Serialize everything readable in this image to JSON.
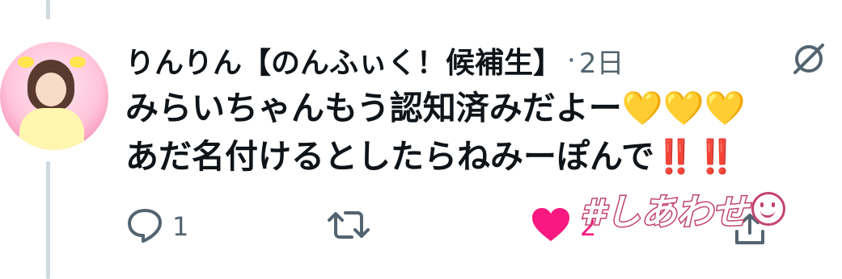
{
  "tweet": {
    "display_name": "りんりん【のんふぃく！候補生】",
    "separator": "·",
    "time": "2日",
    "text_line1": "みらいちゃんもう認知済みだよー",
    "text_line1_emoji": "💛💛💛",
    "text_line2": "あだ名付けるとしたらねみーぽんで",
    "text_line2_emoji": "‼️‼️"
  },
  "actions": {
    "reply_count": "1",
    "retweet_count": "",
    "like_count": "2",
    "like_state": "liked"
  },
  "sticker": {
    "text": "#しあわせ"
  },
  "colors": {
    "text_primary": "#0f1419",
    "text_secondary": "#536471",
    "like_active": "#f91880",
    "thread_line": "#cfd9de",
    "sticker_outline": "#c2446e"
  },
  "icons": {
    "reply": "reply-bubble-icon",
    "retweet": "retweet-arrows-icon",
    "like": "heart-filled-icon",
    "share": "share-icon",
    "header": "mute-circle-slash-icon"
  }
}
